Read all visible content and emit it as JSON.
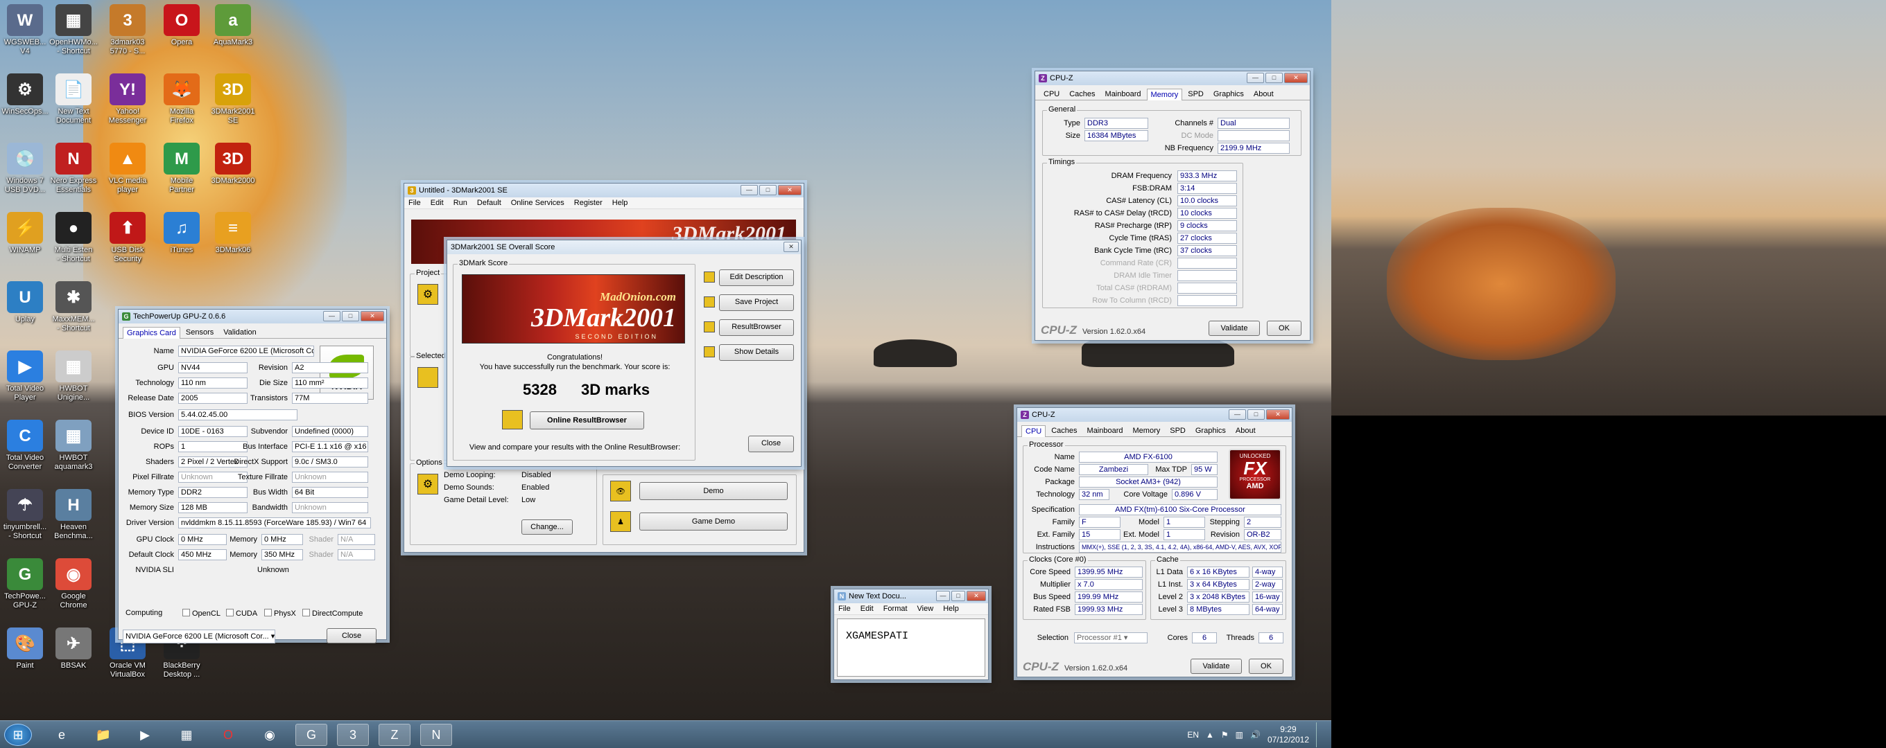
{
  "desktop_icons": [
    {
      "label": "WGSWEB...\nV4",
      "color": "#5a6b8c",
      "glyph": "W"
    },
    {
      "label": "OpenHWMo...\n- Shortcut",
      "color": "#444",
      "glyph": "▦"
    },
    {
      "label": "3dmark03\n5770 - S...",
      "color": "#c57a2a",
      "glyph": "3"
    },
    {
      "label": "Opera",
      "color": "#c8151b",
      "glyph": "O"
    },
    {
      "label": "AquaMark3",
      "color": "#5e9b3a",
      "glyph": "a"
    },
    {
      "label": "WinSecOps...",
      "color": "#333",
      "glyph": "⚙"
    },
    {
      "label": "New Text\nDocument",
      "color": "#eee",
      "glyph": "📄"
    },
    {
      "label": "Yahoo!\nMessenger",
      "color": "#7a2e9a",
      "glyph": "Y!"
    },
    {
      "label": "Mozilla\nFirefox",
      "color": "#e36b18",
      "glyph": "🦊"
    },
    {
      "label": "3DMark2001\nSE",
      "color": "#d8a20a",
      "glyph": "3D"
    },
    {
      "label": "Windows 7\nUSB DVD...",
      "color": "#9bb7d6",
      "glyph": "💿"
    },
    {
      "label": "Nero Express\nEssentials",
      "color": "#c02020",
      "glyph": "N"
    },
    {
      "label": "VLC media\nplayer",
      "color": "#f08a12",
      "glyph": "▲"
    },
    {
      "label": "Mobile\nPartner",
      "color": "#2e9a4a",
      "glyph": "M"
    },
    {
      "label": "3DMark2000",
      "color": "#c2220f",
      "glyph": "3D"
    },
    {
      "label": "WINAMP",
      "color": "#e0a020",
      "glyph": "⚡"
    },
    {
      "label": "Multi Esten\n- Shortcut",
      "color": "#222",
      "glyph": "●"
    },
    {
      "label": "USB Disk\nSecurity",
      "color": "#c01818",
      "glyph": "⬆"
    },
    {
      "label": "iTunes",
      "color": "#2b7fd4",
      "glyph": "♫"
    },
    {
      "label": "3DMark06",
      "color": "#e8a020",
      "glyph": "≡"
    },
    {
      "label": "Uplay",
      "color": "#2d7fc4",
      "glyph": "U"
    },
    {
      "label": "MaxxMEM...\n- Shortcut",
      "color": "#555",
      "glyph": "✱"
    },
    {
      "label": "Total Video\nPlayer",
      "color": "#2b7fe0",
      "glyph": "▶"
    },
    {
      "label": "HWBOT\nUnigine...",
      "color": "#ccc",
      "glyph": "▦"
    },
    {
      "label": "Total Video\nConverter",
      "color": "#2b7fe0",
      "glyph": "C"
    },
    {
      "label": "HWBOT\naquamark3",
      "color": "#7fa0c0",
      "glyph": "▦"
    },
    {
      "label": "tinyumbrell...\n- Shortcut",
      "color": "#445",
      "glyph": "☂"
    },
    {
      "label": "Heaven\nBenchma...",
      "color": "#5a7fa0",
      "glyph": "H"
    },
    {
      "label": "TechPowe...\nGPU-Z",
      "color": "#3a8a3a",
      "glyph": "G"
    },
    {
      "label": "Google\nChrome",
      "color": "#dd4b39",
      "glyph": "◉"
    },
    {
      "label": "Paint",
      "color": "#5a8ad0",
      "glyph": "🎨"
    },
    {
      "label": "BBSAK",
      "color": "#777",
      "glyph": "✈"
    },
    {
      "label": "Oracle VM\nVirtualBox",
      "color": "#2a5fa8",
      "glyph": "⬚"
    },
    {
      "label": "BlackBerry\nDesktop ...",
      "color": "#222",
      "glyph": "⁘"
    }
  ],
  "gpuz": {
    "title": "TechPowerUp GPU-Z 0.6.6",
    "tabs": [
      "Graphics Card",
      "Sensors",
      "Validation"
    ],
    "fields": [
      {
        "label": "Name",
        "value": "NVIDIA GeForce 6200 LE (Microsoft Co..."
      },
      {
        "label": "GPU",
        "value": "NV44",
        "label2": "Revision",
        "value2": "A2"
      },
      {
        "label": "Technology",
        "value": "110 nm",
        "label2": "Die Size",
        "value2": "110 mm²"
      },
      {
        "label": "Release Date",
        "value": "2005",
        "label2": "Transistors",
        "value2": "77M"
      },
      {
        "label": "BIOS Version",
        "value": "5.44.02.45.00"
      },
      {
        "label": "Device ID",
        "value": "10DE - 0163",
        "label2": "Subvendor",
        "value2": "Undefined (0000)"
      },
      {
        "label": "ROPs",
        "value": "1",
        "label2": "Bus Interface",
        "value2": "PCI-E 1.1 x16 @ x16 1.1"
      },
      {
        "label": "Shaders",
        "value": "2 Pixel / 2 Vertex",
        "label2": "DirectX Support",
        "value2": "9.0c / SM3.0"
      },
      {
        "label": "Pixel Fillrate",
        "value": "Unknown",
        "label2": "Texture Fillrate",
        "value2": "Unknown"
      },
      {
        "label": "Memory Type",
        "value": "DDR2",
        "label2": "Bus Width",
        "value2": "64 Bit"
      },
      {
        "label": "Memory Size",
        "value": "128 MB",
        "label2": "Bandwidth",
        "value2": "Unknown"
      },
      {
        "label": "Driver Version",
        "value": "nvlddmkm 8.15.11.8593 (ForceWare 185.93) / Win7 64"
      },
      {
        "label": "GPU Clock",
        "value": "0 MHz",
        "label2": "Memory",
        "value2": "0 MHz",
        "label3": "Shader",
        "value3": "N/A"
      },
      {
        "label": "Default Clock",
        "value": "450 MHz",
        "label2": "Memory",
        "value2": "350 MHz",
        "label3": "Shader",
        "value3": "N/A"
      },
      {
        "label": "NVIDIA SLI",
        "value": "Unknown"
      }
    ],
    "computing_label": "Computing",
    "computing": [
      "OpenCL",
      "CUDA",
      "PhysX",
      "DirectCompute"
    ],
    "select_value": "NVIDIA GeForce 6200 LE (Microsoft Cor...",
    "close": "Close",
    "logo_text": "NVIDIA"
  },
  "tdm": {
    "title": "Untitled - 3DMark2001 SE",
    "menu": [
      "File",
      "Edit",
      "Run",
      "Default",
      "Online Services",
      "Register",
      "Help"
    ],
    "banner": "3DMark2001",
    "project": "Project",
    "selected": "Selected",
    "options": "Options",
    "opts": [
      {
        "label": "Demo Looping:",
        "value": "Disabled"
      },
      {
        "label": "Demo Sounds:",
        "value": "Enabled"
      },
      {
        "label": "Game Detail Level:",
        "value": "Low"
      }
    ],
    "change": "Change...",
    "demo": "Demo",
    "game_demo": "Game Demo"
  },
  "score": {
    "title": "3DMark2001 SE Overall Score",
    "group": "3DMark Score",
    "brand_top": "MadOnion.com",
    "brand_main": "3DMark2001",
    "brand_sub": "SECOND EDITION",
    "congrats": "Congratulations!",
    "msg": "You have successfully run the benchmark. Your score is:",
    "score": "5328",
    "unit": "3D marks",
    "online_btn": "Online ResultBrowser",
    "view_msg": "View and compare your results with the Online ResultBrowser:",
    "side_buttons": [
      "Edit Description",
      "Save Project",
      "ResultBrowser",
      "Show Details"
    ],
    "close": "Close"
  },
  "cpuz_mem": {
    "title": "CPU-Z",
    "tabs": [
      "CPU",
      "Caches",
      "Mainboard",
      "Memory",
      "SPD",
      "Graphics",
      "About"
    ],
    "active": "Memory",
    "general": "General",
    "type_label": "Type",
    "type": "DDR3",
    "channels_label": "Channels #",
    "channels": "Dual",
    "size_label": "Size",
    "size": "16384 MBytes",
    "dcmode_label": "DC Mode",
    "dcmode": "",
    "nbf_label": "NB Frequency",
    "nbf": "2199.9 MHz",
    "timings": "Timings",
    "timing_rows": [
      {
        "label": "DRAM Frequency",
        "value": "933.3 MHz",
        "dim": false
      },
      {
        "label": "FSB:DRAM",
        "value": "3:14",
        "dim": false
      },
      {
        "label": "CAS# Latency (CL)",
        "value": "10.0 clocks",
        "dim": false
      },
      {
        "label": "RAS# to CAS# Delay (tRCD)",
        "value": "10 clocks",
        "dim": false
      },
      {
        "label": "RAS# Precharge (tRP)",
        "value": "9 clocks",
        "dim": false
      },
      {
        "label": "Cycle Time (tRAS)",
        "value": "27 clocks",
        "dim": false
      },
      {
        "label": "Bank Cycle Time (tRC)",
        "value": "37 clocks",
        "dim": false
      },
      {
        "label": "Command Rate (CR)",
        "value": "",
        "dim": true
      },
      {
        "label": "DRAM Idle Timer",
        "value": "",
        "dim": true
      },
      {
        "label": "Total CAS# (tRDRAM)",
        "value": "",
        "dim": true
      },
      {
        "label": "Row To Column (tRCD)",
        "value": "",
        "dim": true
      }
    ],
    "brand": "CPU-Z",
    "version": "Version 1.62.0.x64",
    "validate": "Validate",
    "ok": "OK"
  },
  "cpuz_cpu": {
    "title": "CPU-Z",
    "tabs": [
      "CPU",
      "Caches",
      "Mainboard",
      "Memory",
      "SPD",
      "Graphics",
      "About"
    ],
    "active": "CPU",
    "processor": "Processor",
    "name_label": "Name",
    "name": "AMD FX-6100",
    "codename_label": "Code Name",
    "codename": "Zambezi",
    "tdp_label": "Max TDP",
    "tdp": "95 W",
    "package_label": "Package",
    "package": "Socket AM3+ (942)",
    "tech_label": "Technology",
    "tech": "32 nm",
    "cv_label": "Core Voltage",
    "cv": "0.896 V",
    "spec_label": "Specification",
    "spec": "AMD FX(tm)-6100 Six-Core Processor",
    "family_label": "Family",
    "family": "F",
    "model_label": "Model",
    "model": "1",
    "stepping_label": "Stepping",
    "stepping": "2",
    "extfam_label": "Ext. Family",
    "extfam": "15",
    "extmodel_label": "Ext. Model",
    "extmodel": "1",
    "revision_label": "Revision",
    "revision": "OR-B2",
    "instr_label": "Instructions",
    "instr": "MMX(+), SSE (1, 2, 3, 3S, 4.1, 4.2, 4A), x86-64, AMD-V, AES, AVX, XOP",
    "clocks": "Clocks (Core #0)",
    "core_speed_label": "Core Speed",
    "core_speed": "1399.95 MHz",
    "mult_label": "Multiplier",
    "mult": "x 7.0",
    "bus_label": "Bus Speed",
    "bus": "199.99 MHz",
    "fsb_label": "Rated FSB",
    "fsb": "1999.93 MHz",
    "cache": "Cache",
    "cache_rows": [
      {
        "label": "L1 Data",
        "value": "6 x 16 KBytes",
        "way": "4-way"
      },
      {
        "label": "L1 Inst.",
        "value": "3 x 64 KBytes",
        "way": "2-way"
      },
      {
        "label": "Level 2",
        "value": "3 x 2048 KBytes",
        "way": "16-way"
      },
      {
        "label": "Level 3",
        "value": "8 MBytes",
        "way": "64-way"
      }
    ],
    "selection_label": "Selection",
    "selection": "Processor #1",
    "cores_label": "Cores",
    "cores": "6",
    "threads_label": "Threads",
    "threads": "6",
    "badge_top": "UNLOCKED",
    "badge_main": "FX",
    "badge_sub": "PROCESSOR",
    "badge_brand": "AMD",
    "brand": "CPU-Z",
    "version": "Version 1.62.0.x64",
    "validate": "Validate",
    "ok": "OK"
  },
  "notepad": {
    "title": "New Text Docu...",
    "menu": [
      "File",
      "Edit",
      "Format",
      "View",
      "Help"
    ],
    "text": "XGAMESPATI"
  },
  "taskbar": {
    "lang": "EN",
    "time": "9:29",
    "date": "07/12/2012"
  },
  "colors": {
    "accent": "#0000b0",
    "cpuz_value": "#000080",
    "score_bg": "#b8251c"
  }
}
